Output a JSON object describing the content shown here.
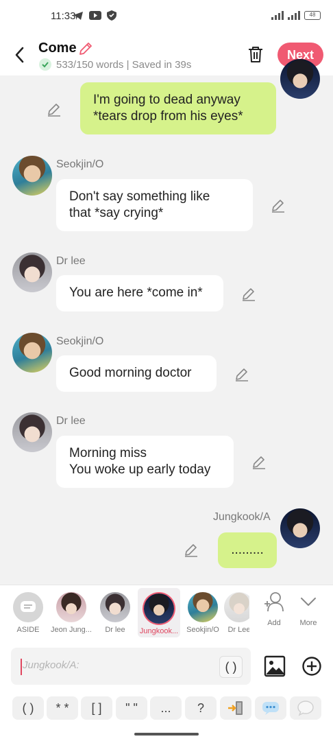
{
  "status_bar": {
    "time": "11:33",
    "battery": "48"
  },
  "header": {
    "title": "Come",
    "meta": "533/150 words | Saved in 39s",
    "next_label": "Next"
  },
  "messages": [
    {
      "sender": "",
      "text": "I'm going to dead anyway\n*tears drop from his eyes*",
      "side": "right"
    },
    {
      "sender": "Seokjin/O",
      "text": "Don't say something like\nthat *say crying*",
      "side": "left"
    },
    {
      "sender": "Dr lee",
      "text": "You are here *come in*",
      "side": "left"
    },
    {
      "sender": "Seokjin/O",
      "text": "Good morning doctor",
      "side": "left"
    },
    {
      "sender": "Dr lee",
      "text": "Morning miss\nYou woke up early today",
      "side": "left"
    },
    {
      "sender": "Jungkook/A",
      "text": ".........",
      "side": "right"
    }
  ],
  "characters": [
    {
      "label": "ASIDE"
    },
    {
      "label": "Jeon Jung..."
    },
    {
      "label": "Dr lee"
    },
    {
      "label": "Jungkook...",
      "selected": true
    },
    {
      "label": "Seokjin/O"
    },
    {
      "label": "Dr Lee"
    }
  ],
  "char_actions": {
    "add": "Add",
    "more": "More"
  },
  "input": {
    "placeholder": "Jungkook/A:",
    "paren_button": "( )"
  },
  "symbols": [
    "( )",
    "* *",
    "[ ]",
    "\" \"",
    "...",
    "?"
  ],
  "colors": {
    "accent": "#f05a72",
    "my_bubble": "#d6f28b",
    "background": "#f2f2f2"
  }
}
